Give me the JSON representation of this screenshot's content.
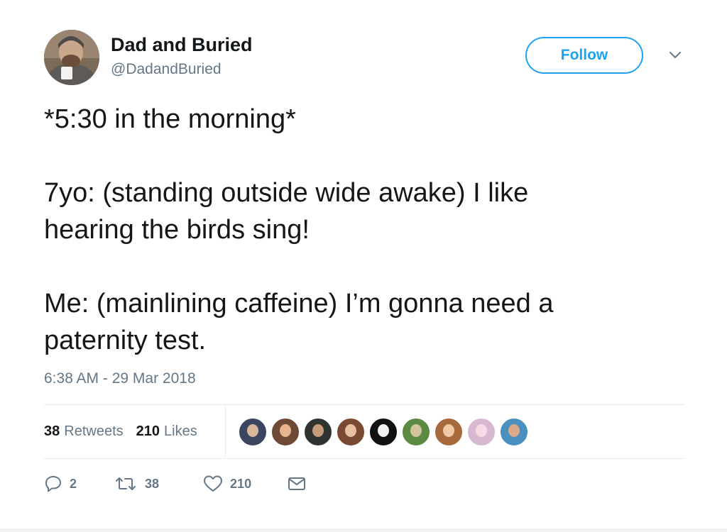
{
  "author": {
    "name": "Dad and Buried",
    "handle": "@DadandBuried"
  },
  "header": {
    "follow_label": "Follow",
    "caret_icon": "chevron-down-icon"
  },
  "tweet": {
    "line1": "*5:30 in the morning*",
    "line2": "7yo: (standing outside wide awake) I like",
    "line3": "hearing the birds sing!",
    "line4": "Me: (mainlining caffeine) I’m gonna need a",
    "line5": "paternity test.",
    "timestamp": "6:38 AM - 29 Mar 2018"
  },
  "stats": {
    "retweets_count": "38",
    "retweets_label": "Retweets",
    "likes_count": "210",
    "likes_label": "Likes"
  },
  "likers": [
    {
      "name": "liker-avatar-1",
      "bg": "#3a4660",
      "face": "#d9b59a"
    },
    {
      "name": "liker-avatar-2",
      "bg": "#6e4a36",
      "face": "#e7b48f"
    },
    {
      "name": "liker-avatar-3",
      "bg": "#2f3430",
      "face": "#c79c7c"
    },
    {
      "name": "liker-avatar-4",
      "bg": "#7a4a33",
      "face": "#e9c0a0"
    },
    {
      "name": "liker-avatar-5",
      "bg": "#111111",
      "face": "#f2f2f2"
    },
    {
      "name": "liker-avatar-6",
      "bg": "#5d8a42",
      "face": "#d2c49b"
    },
    {
      "name": "liker-avatar-7",
      "bg": "#a86a3c",
      "face": "#f0c9a6"
    },
    {
      "name": "liker-avatar-8",
      "bg": "#d7b7d2",
      "face": "#f6dbe6"
    },
    {
      "name": "liker-avatar-9",
      "bg": "#4b8fbf",
      "face": "#d9a98a"
    }
  ],
  "actions": {
    "reply_count": "2",
    "retweet_count": "38",
    "like_count": "210"
  },
  "colors": {
    "accent": "#1da1f2",
    "secondary_text": "#657786",
    "primary_text": "#14171a",
    "divider": "#e6ecf0"
  }
}
